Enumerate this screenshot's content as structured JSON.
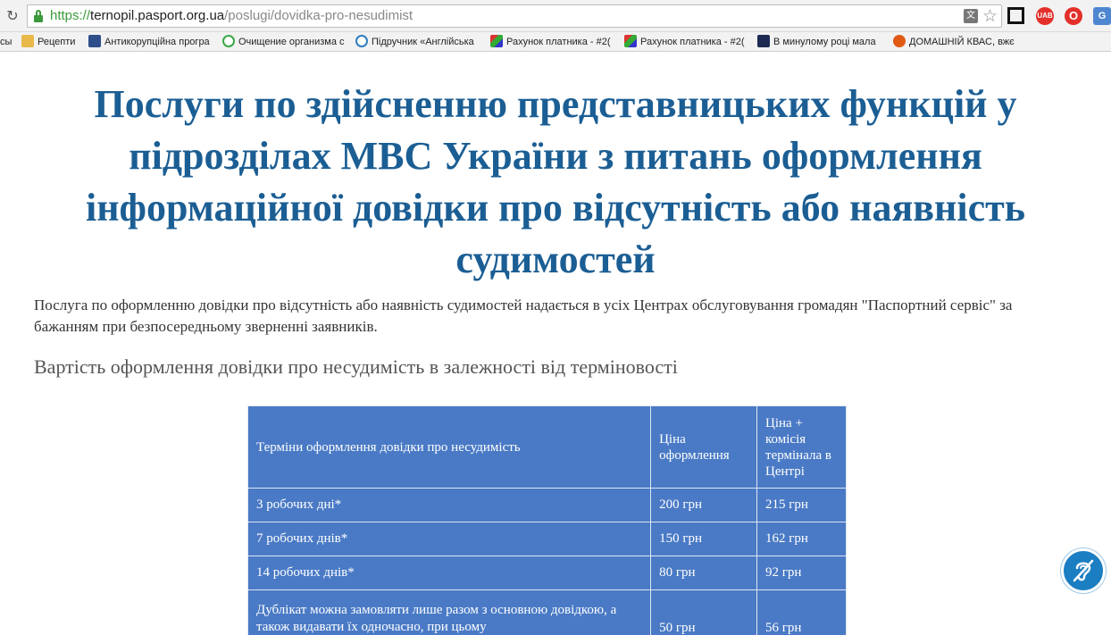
{
  "browser": {
    "url_scheme": "https://",
    "url_host": "ternopil.pasport.org.ua",
    "url_path": "/poslugi/dovidka-pro-nesudimist",
    "icons": [
      "reload-icon",
      "lock-icon",
      "translate-icon",
      "star-icon"
    ],
    "extensions": [
      {
        "name": "bracket-extension-icon",
        "label": ""
      },
      {
        "name": "uab-extension-icon",
        "label": "UAB"
      },
      {
        "name": "opera-extension-icon",
        "label": "O"
      },
      {
        "name": "google-extension-icon",
        "label": "G"
      }
    ],
    "bookmarks": [
      {
        "label": "сы",
        "icon": "none"
      },
      {
        "label": "Рецепти",
        "icon": "folder-icon"
      },
      {
        "label": "Антикорупційна програ",
        "icon": "site-icon"
      },
      {
        "label": "Очищение организма с",
        "icon": "site-icon"
      },
      {
        "label": "Підручник «Англійська",
        "icon": "site-icon"
      },
      {
        "label": "Рахунок платника - #2(",
        "icon": "site-icon"
      },
      {
        "label": "Рахунок платника - #2(",
        "icon": "site-icon"
      },
      {
        "label": "В минулому році мала",
        "icon": "site-icon"
      },
      {
        "label": "ДОМАШНІЙ КВАС, вжє",
        "icon": "site-icon"
      }
    ]
  },
  "page": {
    "title": "Послуги по здійсненню представницьких функцій у підрозділах МВС України з питань оформлення інформаційної довідки про відсутність або наявність судимостей",
    "intro": "Послуга по оформленню довідки про відсутність або наявність судимостей надається в усіх Центрах обслуговування громадян \"Паспортний сервіс\" за бажанням при безпосередньому зверненні заявників.",
    "subheading": "Вартість оформлення довідки про несудимість в залежності від терміновості",
    "table": {
      "headers": [
        "Терміни оформлення довідки про несудимість",
        "Ціна оформлення",
        "Ціна + комісія терміналa в Центрі"
      ],
      "rows": [
        [
          "3 робочих дні*",
          "200 грн",
          "215 грн"
        ],
        [
          "7 робочих днів*",
          "150 грн",
          "162 грн"
        ],
        [
          "14 робочих днів*",
          "80 грн",
          "92 грн"
        ],
        [
          "Дублікат можна замовляти лише разом з основною довідкою, а також видавати їх одночасно, при цьому",
          "50 грн",
          "56 грн"
        ]
      ]
    }
  },
  "widgets": {
    "accessibility": "ear-icon"
  },
  "colors": {
    "title": "#1b5e94",
    "table_bg": "#4a7ac5",
    "accessibility_button": "#1b7ec2"
  }
}
